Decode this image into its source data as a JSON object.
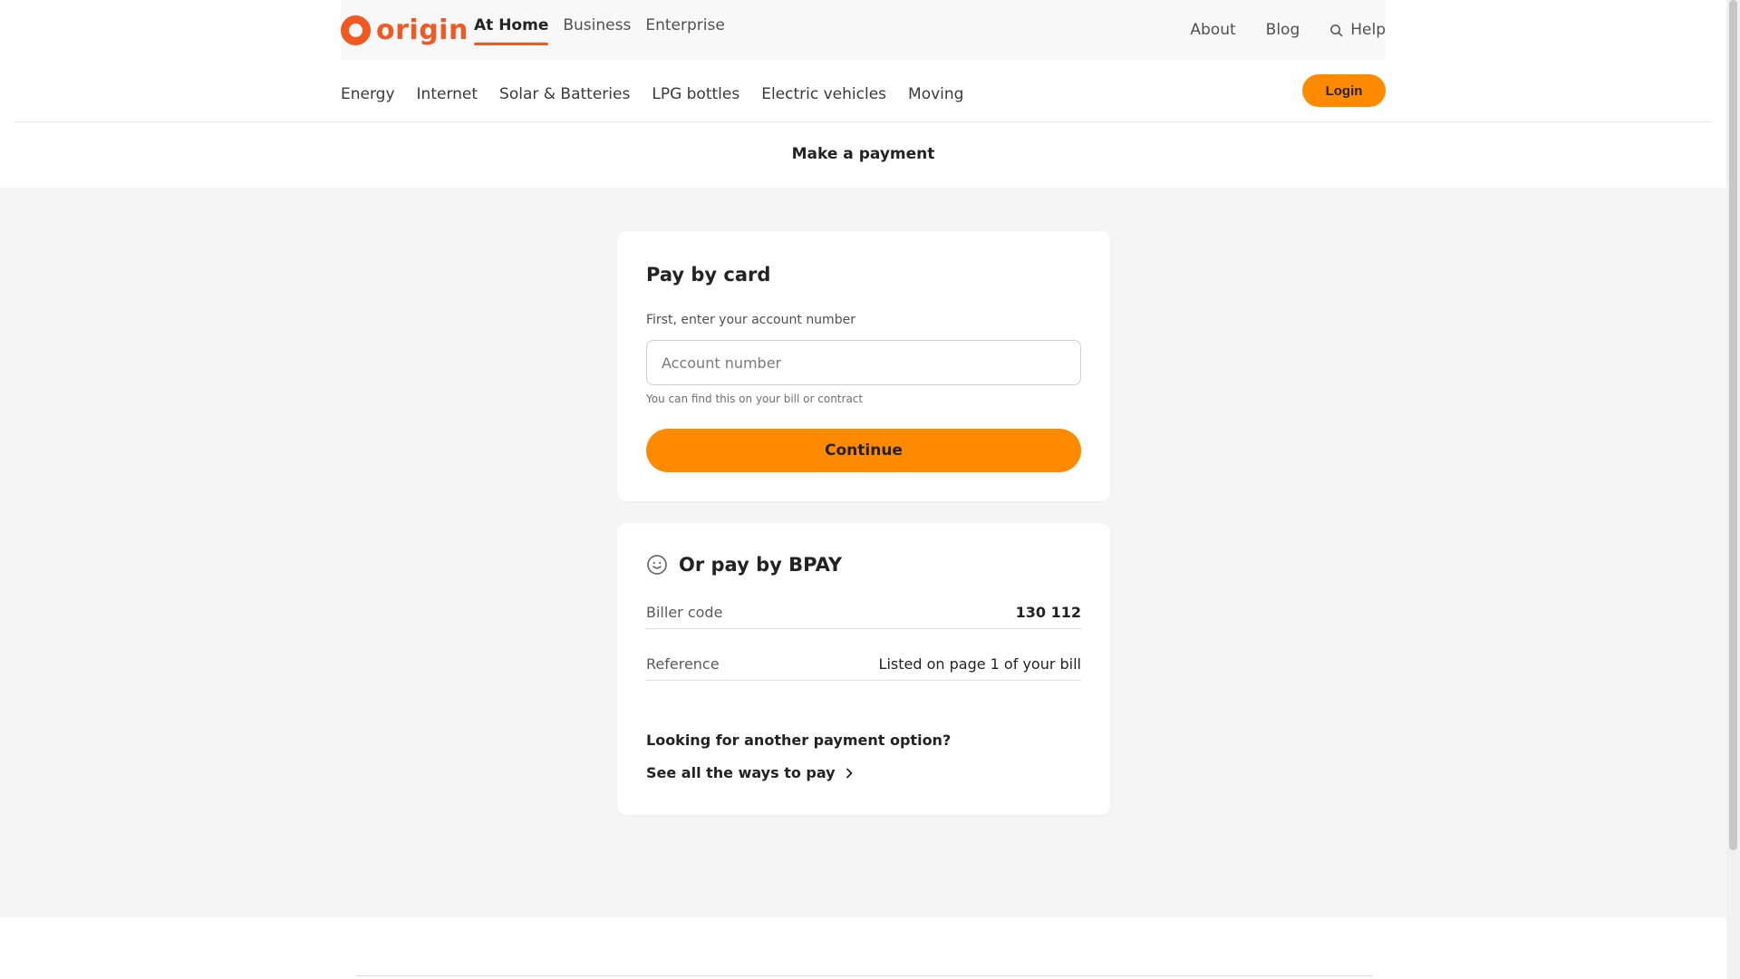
{
  "brand": {
    "name": "origin",
    "accent": "#f05a22",
    "button_color": "#ff8a00"
  },
  "segment_nav": [
    {
      "label": "At Home",
      "active": true
    },
    {
      "label": "Business",
      "active": false
    },
    {
      "label": "Enterprise",
      "active": false
    }
  ],
  "util_nav": {
    "about": "About",
    "blog": "Blog",
    "help": "Help",
    "help_icon": "search-icon"
  },
  "main_nav": [
    "Energy",
    "Internet",
    "Solar & Batteries",
    "LPG bottles",
    "Electric vehicles",
    "Moving"
  ],
  "login_label": "Login",
  "page_title": "Make a payment",
  "card_pay": {
    "title": "Pay by card",
    "field_label": "First, enter your account number",
    "placeholder": "Account number",
    "value": "",
    "hint": "You can find this on your bill or contract",
    "button": "Continue"
  },
  "card_bpay": {
    "icon": "smiley-icon",
    "title": "Or pay by BPAY",
    "rows": [
      {
        "label": "Biller code",
        "value": "130 112"
      },
      {
        "label": "Reference",
        "value": "Listed on page 1 of your bill"
      }
    ],
    "question": "Looking for another payment option?",
    "link": "See all the ways to pay",
    "link_icon": "chevron-right-icon"
  }
}
